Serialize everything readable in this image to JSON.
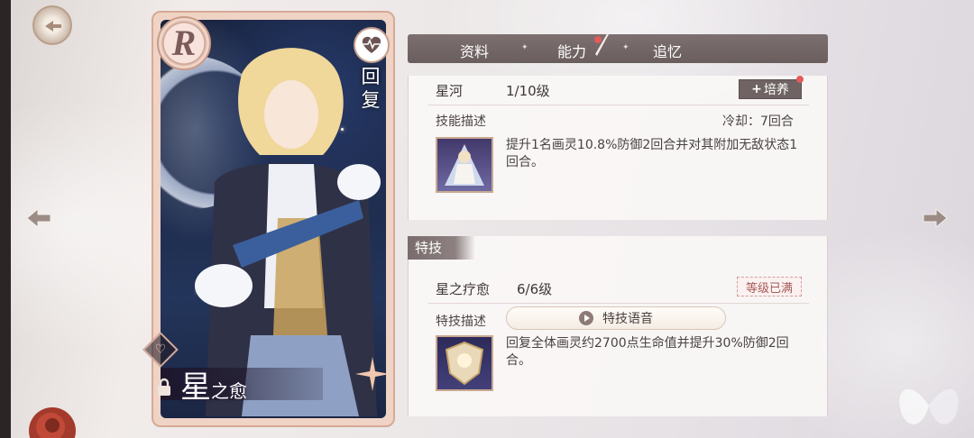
{
  "card": {
    "rarity": "R",
    "type_label": "回复",
    "name_big": "星",
    "name_small": "之愈"
  },
  "tabs": [
    {
      "label": "资料",
      "active": false
    },
    {
      "label": "能力",
      "active": true
    },
    {
      "label": "追忆",
      "active": false
    }
  ],
  "skill": {
    "name": "星河",
    "level": "1/10级",
    "cultivate_label": "培养",
    "desc_title": "技能描述",
    "cooldown": "冷却：7回合",
    "description": "提升1名画灵10.8%防御2回合并对其附加无敌状态1回合。"
  },
  "trait": {
    "header": "特技",
    "name": "星之疗愈",
    "level": "6/6级",
    "max_badge": "等级已满",
    "desc_title": "特技描述",
    "voice_label": "特技语音",
    "description": "回复全体画灵约2700点生命值并提升30%防御2回合。"
  },
  "colors": {
    "accent": "#6f6363",
    "notify": "#e25b5b",
    "card_frame": "#efd3c5"
  },
  "icons": [
    "heart-monitor-icon",
    "heart-icon",
    "lock-icon",
    "plus-icon",
    "play-icon",
    "arrow-left-icon",
    "arrow-right-icon",
    "quill-icon"
  ]
}
